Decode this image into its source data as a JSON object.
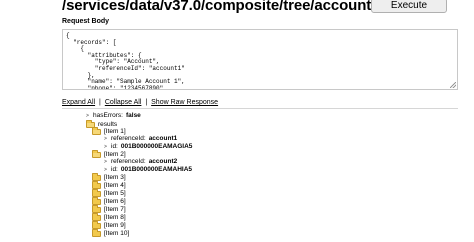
{
  "endpoint": "/services/data/v37.0/composite/tree/account",
  "execute_label": "Execute",
  "request_body_label": "Request Body",
  "request_body_text": "{\n  \"records\": [\n    {\n      \"attributes\": {\n        \"type\": \"Account\",\n        \"referenceId\": \"account1\"\n      },\n      \"name\": \"Sample Account 1\",\n      \"phone\": \"1234567890\",",
  "links": {
    "expand_all": "Expand All",
    "collapse_all": "Collapse All",
    "show_raw": "Show Raw Response",
    "separator": "|"
  },
  "tree": {
    "has_errors_key": "hasErrors:",
    "has_errors_value": "false",
    "results_label": "results",
    "item1_label": "[Item 1]",
    "item1_ref_key": "referenceId:",
    "item1_ref_value": "account1",
    "item1_id_key": "id:",
    "item1_id_value": "001B000000EAMAGIA5",
    "item2_label": "[Item 2]",
    "item2_ref_key": "referenceId:",
    "item2_ref_value": "account2",
    "item2_id_key": "id:",
    "item2_id_value": "001B000000EAMAHIA5",
    "collapsed_items": [
      "[Item 3]",
      "[Item 4]",
      "[Item 5]",
      "[Item 6]",
      "[Item 7]",
      "[Item 8]",
      "[Item 9]",
      "[Item 10]"
    ]
  },
  "colors": {
    "folder_fill": "#f2c94c",
    "folder_stroke": "#c79a2a",
    "textarea_border": "#c8c8c8"
  }
}
